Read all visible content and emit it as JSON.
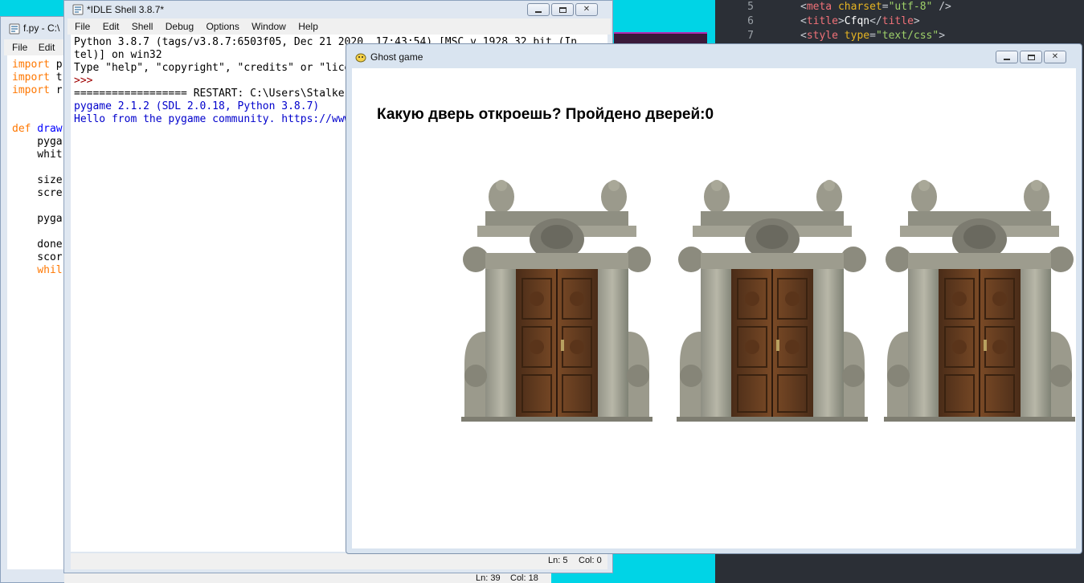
{
  "code_editor": {
    "lines": [
      {
        "num": "5",
        "parts": [
          [
            "tok-punct",
            "<"
          ],
          [
            "tok-tag",
            "meta"
          ],
          [
            "tok-attr",
            " charset"
          ],
          [
            "tok-punct",
            "="
          ],
          [
            "tok-str",
            "\"utf-8\""
          ],
          [
            "tok-punct",
            " />"
          ]
        ]
      },
      {
        "num": "6",
        "parts": [
          [
            "tok-punct",
            "<"
          ],
          [
            "tok-tag",
            "title"
          ],
          [
            "tok-punct",
            ">"
          ],
          [
            "tok-txt",
            "Cfqn"
          ],
          [
            "tok-punct",
            "</"
          ],
          [
            "tok-tag",
            "title"
          ],
          [
            "tok-punct",
            ">"
          ]
        ]
      },
      {
        "num": "7",
        "parts": [
          [
            "tok-punct",
            "<"
          ],
          [
            "tok-tag",
            "style"
          ],
          [
            "tok-attr",
            " type"
          ],
          [
            "tok-punct",
            "="
          ],
          [
            "tok-str",
            "\"text/css\""
          ],
          [
            "tok-punct",
            ">"
          ]
        ]
      }
    ]
  },
  "fpy_window": {
    "title": "f.py - C:\\",
    "menu": [
      "File",
      "Edit"
    ],
    "code_lines": [
      [
        [
          "kw-or",
          "import"
        ],
        [
          "kw-bl",
          " p"
        ]
      ],
      [
        [
          "kw-or",
          "import"
        ],
        [
          "kw-bl",
          " t"
        ]
      ],
      [
        [
          "kw-or",
          "import"
        ],
        [
          "kw-bl",
          " r"
        ]
      ],
      [],
      [],
      [
        [
          "kw-or",
          "def"
        ],
        [
          "fn-bl",
          " draw"
        ]
      ],
      [
        [
          "kw-bl",
          "    pyga"
        ]
      ],
      [
        [
          "kw-bl",
          "    whit"
        ]
      ],
      [],
      [
        [
          "kw-bl",
          "    size"
        ]
      ],
      [
        [
          "kw-bl",
          "    scre"
        ]
      ],
      [],
      [
        [
          "kw-bl",
          "    pyga"
        ]
      ],
      [],
      [
        [
          "kw-bl",
          "    done"
        ]
      ],
      [
        [
          "kw-bl",
          "    scor"
        ]
      ],
      [
        [
          "kw-or",
          "    whil"
        ]
      ]
    ],
    "status_ln": "Ln: 39",
    "status_col": "Col: 18"
  },
  "idle_window": {
    "title": "*IDLE Shell 3.8.7*",
    "menu": [
      "File",
      "Edit",
      "Shell",
      "Debug",
      "Options",
      "Window",
      "Help"
    ],
    "lines": [
      {
        "cls": "c-black",
        "text": "Python 3.8.7 (tags/v3.8.7:6503f05, Dec 21 2020, 17:43:54) [MSC v.1928 32 bit (In"
      },
      {
        "cls": "c-black",
        "text": "tel)] on win32"
      },
      {
        "cls": "c-black",
        "text": "Type \"help\", \"copyright\", \"credits\" or \"license()\" for more information."
      },
      {
        "cls": "c-red",
        "text": ">>>"
      },
      {
        "cls": "c-black",
        "text": "================== RESTART: C:\\Users\\Stalker\\f.py"
      },
      {
        "cls": "c-blue",
        "text": "pygame 2.1.2 (SDL 2.0.18, Python 3.8.7)"
      },
      {
        "cls": "c-blue",
        "text": "Hello from the pygame community. https://www.pygame.org/contribute.html"
      }
    ],
    "status_ln": "Ln: 5",
    "status_col": "Col: 0"
  },
  "ghost_window": {
    "title": "Ghost game",
    "prompt": "Какую дверь откроешь? Пройдено дверей:0",
    "doors": [
      "door-1",
      "door-2",
      "door-3"
    ]
  }
}
